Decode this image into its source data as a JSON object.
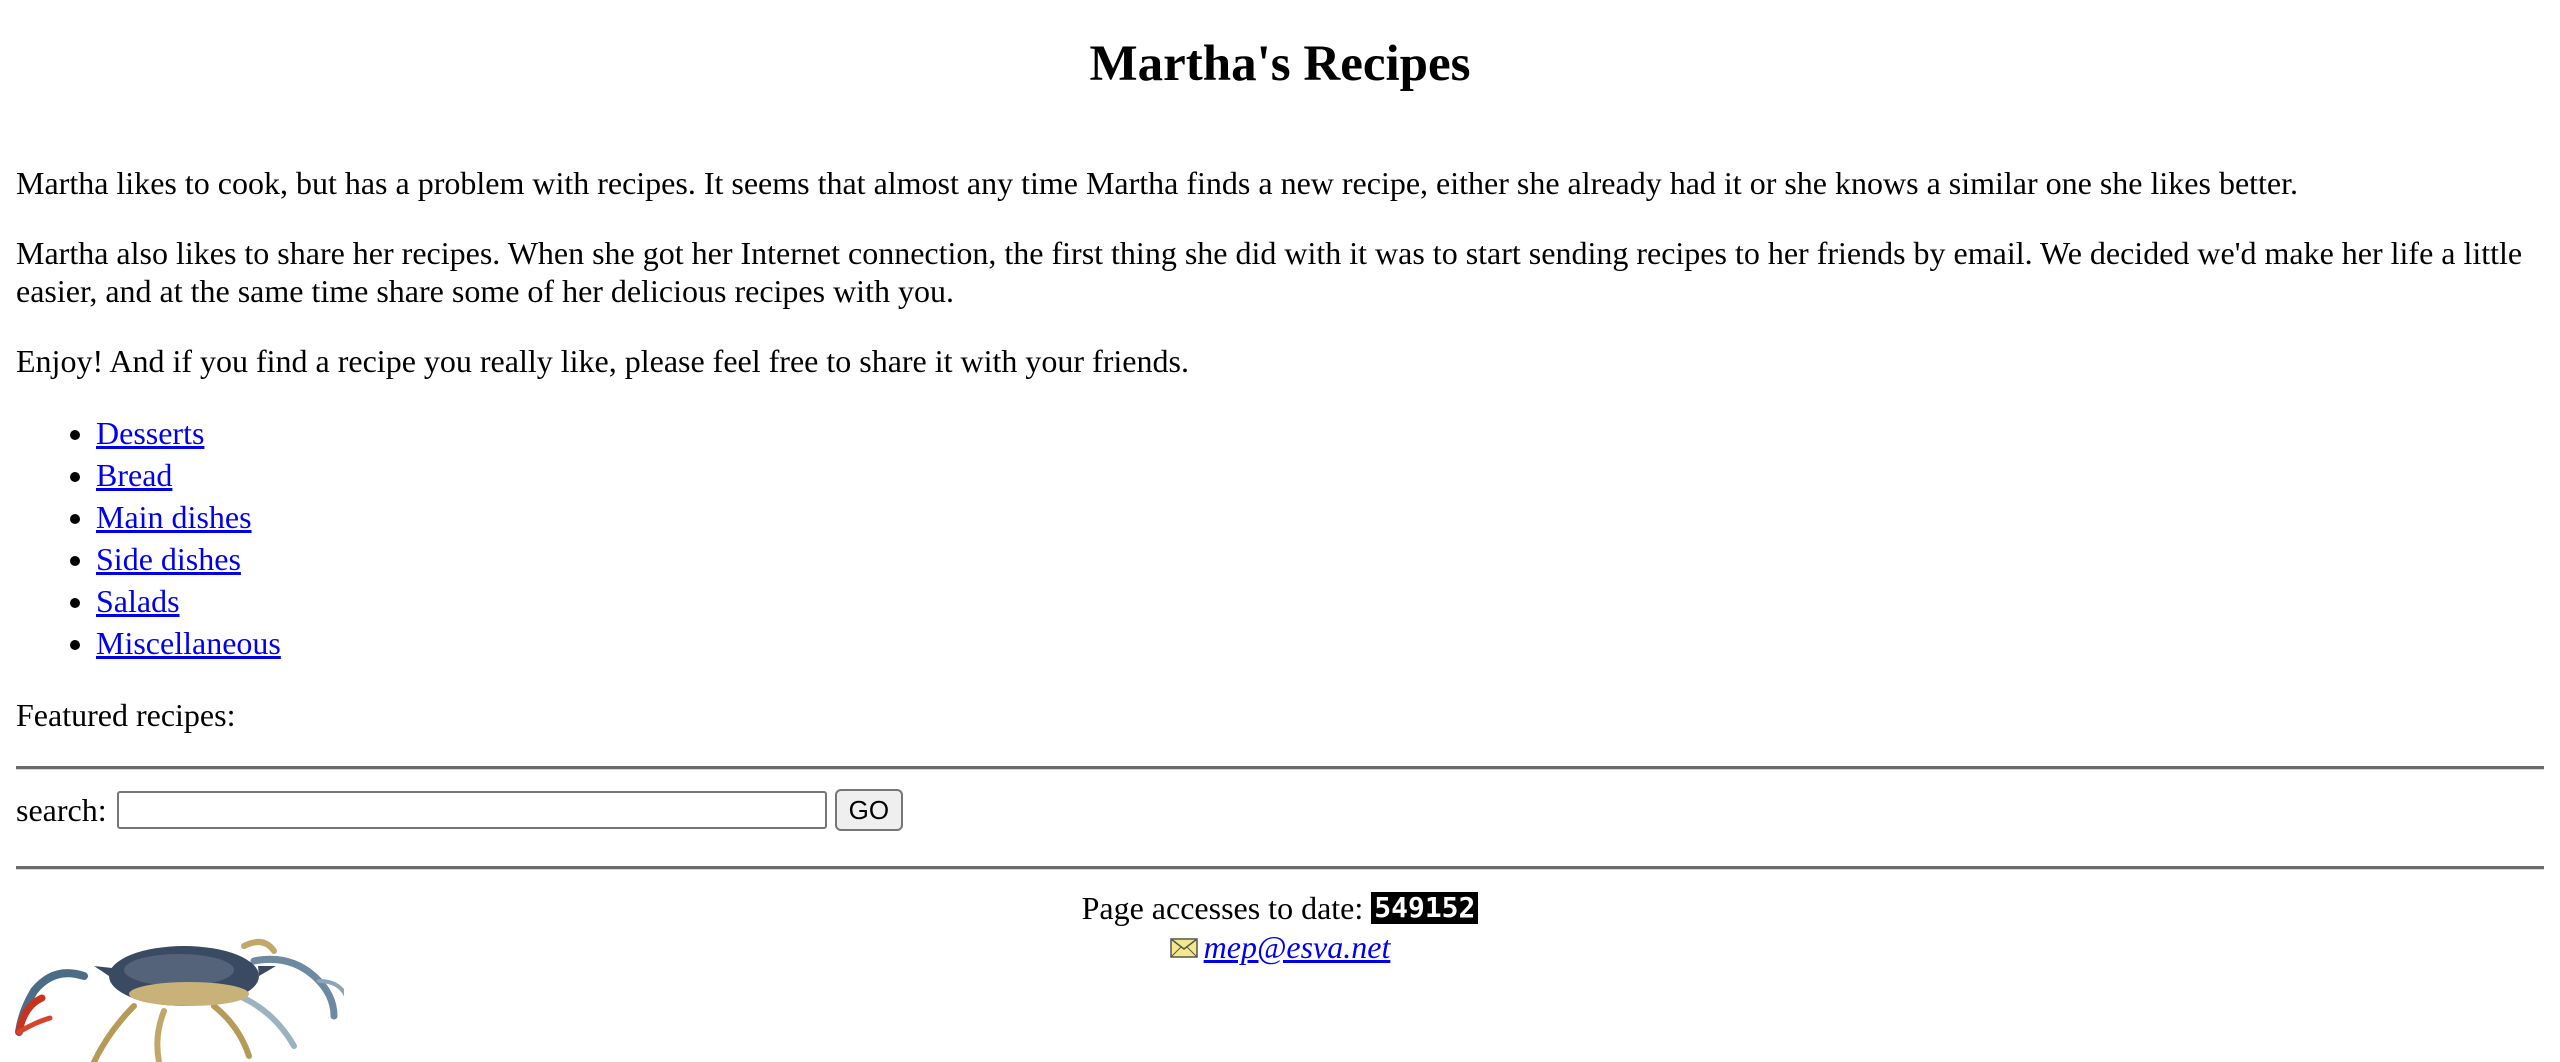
{
  "header": {
    "title": "Martha's Recipes"
  },
  "intro": {
    "p1": "Martha likes to cook, but has a problem with recipes. It seems that almost any time Martha finds a new recipe, either she already had it or she knows a similar one she likes better.",
    "p2": "Martha also likes to share her recipes. When she got her Internet connection, the first thing she did with it was to start sending recipes to her friends by email. We decided we'd make her life a little easier, and at the same time share some of her delicious recipes with you.",
    "p3": "Enjoy! And if you find a recipe you really like, please feel free to share it with your friends."
  },
  "categories": [
    {
      "label": "Desserts"
    },
    {
      "label": "Bread"
    },
    {
      "label": "Main dishes"
    },
    {
      "label": "Side dishes"
    },
    {
      "label": "Salads"
    },
    {
      "label": "Miscellaneous"
    }
  ],
  "featured": {
    "label": "Featured recipes:"
  },
  "search": {
    "label": "search:",
    "value": "",
    "button_label": "GO"
  },
  "footer": {
    "counter_label": "Page accesses to date:",
    "counter_value": "549152",
    "email": "mep@esva.net",
    "mail_icon": "envelope-icon",
    "image": "blue-crab-image"
  },
  "colors": {
    "link": "#0000ee",
    "counter_bg": "#000000",
    "counter_fg": "#ffffff"
  }
}
